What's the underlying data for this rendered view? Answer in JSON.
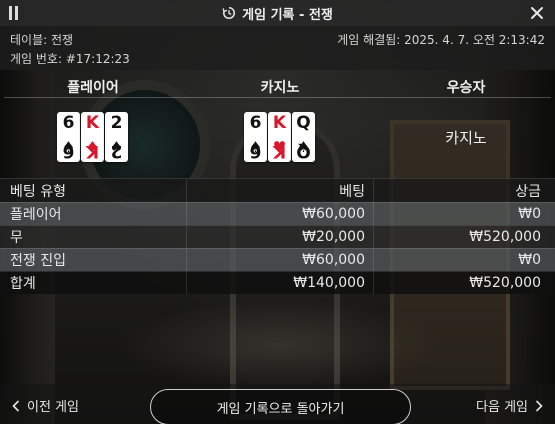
{
  "topbar": {
    "title": "게임 기록 - 전쟁",
    "menu_icon": "pause-menu-icon",
    "history_icon": "history-icon",
    "close_icon": "close-icon"
  },
  "info": {
    "table_label": "테이블: 전쟁",
    "resolved_label": "게임 해결됨: 2025. 4. 7. 오전 2:13:42",
    "game_number_label": "게임 번호: #17:12:23"
  },
  "results": {
    "headers": {
      "player": "플레이어",
      "casino": "카지노",
      "winner": "우승자"
    },
    "player_cards": [
      {
        "rank": "6",
        "suit": "♠",
        "color": "black"
      },
      {
        "rank": "K",
        "suit": "♦",
        "color": "red"
      },
      {
        "rank": "2",
        "suit": "♠",
        "color": "black"
      }
    ],
    "casino_cards": [
      {
        "rank": "6",
        "suit": "♠",
        "color": "black"
      },
      {
        "rank": "K",
        "suit": "♥",
        "color": "red"
      },
      {
        "rank": "Q",
        "suit": "♠",
        "color": "black"
      }
    ],
    "winner": "카지노"
  },
  "bets": {
    "headers": {
      "type": "베팅 유형",
      "bet": "베팅",
      "payout": "상금"
    },
    "rows": [
      {
        "type": "플레이어",
        "bet": "₩60,000",
        "payout": "₩0"
      },
      {
        "type": "무",
        "bet": "₩20,000",
        "payout": "₩520,000"
      },
      {
        "type": "전쟁 진입",
        "bet": "₩60,000",
        "payout": "₩0"
      }
    ],
    "total": {
      "type": "합계",
      "bet": "₩140,000",
      "payout": "₩520,000"
    }
  },
  "bottom": {
    "prev_label": "이전 게임",
    "back_label": "게임 기록으로 돌아가기",
    "next_label": "다음 게임"
  },
  "colors": {
    "red_suit": "#d8172b",
    "black_suit": "#111111",
    "topbar_bg": "#282828"
  }
}
